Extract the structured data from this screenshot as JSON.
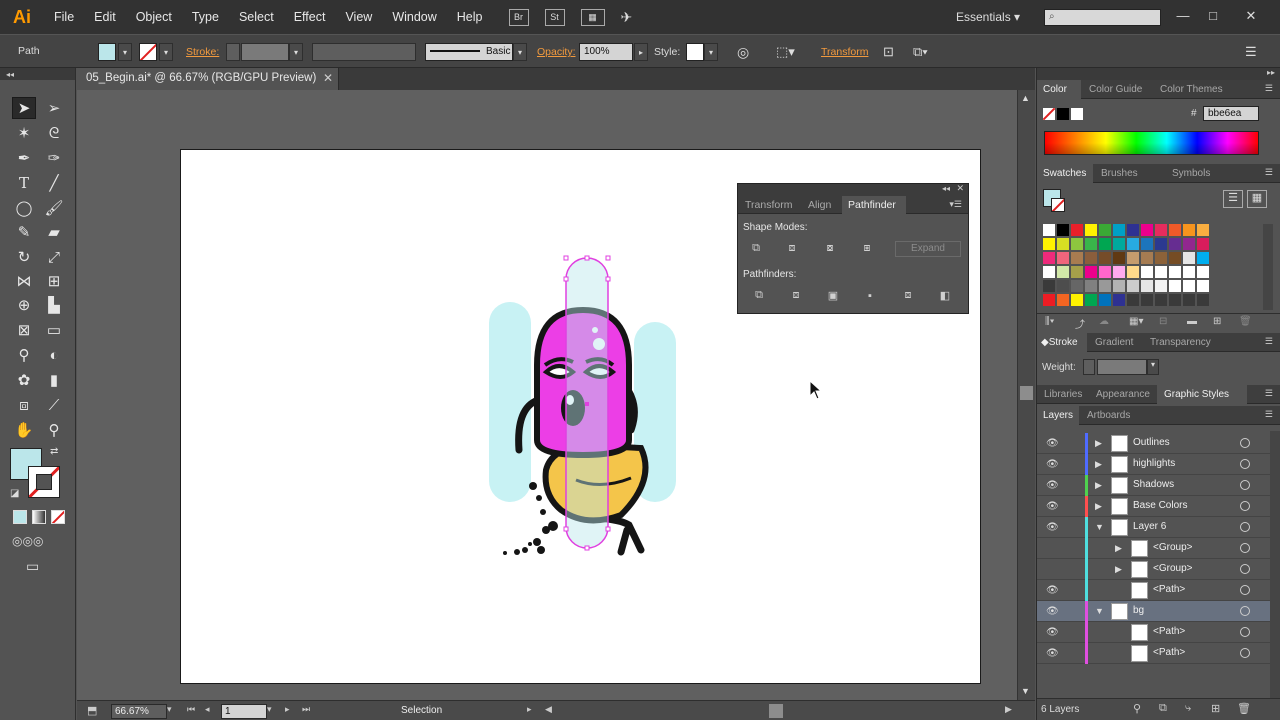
{
  "app": {
    "logo": "Ai",
    "menu": [
      "File",
      "Edit",
      "Object",
      "Type",
      "Select",
      "Effect",
      "View",
      "Window",
      "Help"
    ],
    "bridge_btn": "Br",
    "stock_btn": "St",
    "workspace": "Essentials"
  },
  "control": {
    "selection_type": "Path",
    "stroke_label": "Stroke:",
    "brush_label": "Basic",
    "opacity_label": "Opacity:",
    "opacity_value": "100%",
    "style_label": "Style:",
    "transform_label": "Transform",
    "fill_color": "#bbe6ea"
  },
  "document": {
    "tab_title": "05_Begin.ai* @ 66.67% (RGB/GPU Preview)",
    "zoom": "66.67%",
    "artboard": "1",
    "status_tool": "Selection"
  },
  "pathfinder": {
    "tabs": [
      "Transform",
      "Align",
      "Pathfinder"
    ],
    "shape_modes_label": "Shape Modes:",
    "pathfinders_label": "Pathfinders:",
    "expand_label": "Expand"
  },
  "color_panel": {
    "tabs": [
      "Color",
      "Color Guide",
      "Color Themes"
    ],
    "hex_label": "#",
    "hex": "bbe6ea"
  },
  "swatches_panel": {
    "tabs": [
      "Swatches",
      "Brushes",
      "Symbols"
    ],
    "rows": [
      [
        "#ffffff",
        "#000000",
        "#e8202a",
        "#fff200",
        "#3aa935",
        "#00a0c6",
        "#2e3192",
        "#ec008c",
        "#e62c5d",
        "#f05a28",
        "#f7941d",
        "#f9ae40"
      ],
      [
        "#fff200",
        "#d7df23",
        "#8dc63f",
        "#39b54a",
        "#00a651",
        "#00a99d",
        "#27aae1",
        "#1c75bc",
        "#2b3990",
        "#662d91",
        "#92278f",
        "#d91c5c"
      ],
      [
        "#ee2a7b",
        "#f0657c",
        "#a97c50",
        "#8b5e3c",
        "#754c29",
        "#603913",
        "#c69c6d",
        "#a67c52",
        "#8c6239",
        "#754c24",
        "#e6e6e6",
        "#00aeef"
      ],
      [
        "#ffffff",
        "#d2e8a8",
        "#a6a04a",
        "#ec008c",
        "#ff66cc",
        "#ffaaee",
        "#ffd98a",
        "#ffffff",
        "#ffffff",
        "#ffffff",
        "#ffffff",
        "#ffffff"
      ],
      [
        "#3a3a3a",
        "#4d4d4d",
        "#666666",
        "#808080",
        "#999999",
        "#b3b3b3",
        "#cccccc",
        "#e6e6e6",
        "#f2f2f2",
        "#ffffff",
        "#ffffff",
        "#ffffff"
      ],
      [
        "#ed1c24",
        "#f26522",
        "#fff200",
        "#00a651",
        "#0072bc",
        "#2e3192",
        "#3a3a3a",
        "#3a3a3a",
        "#3a3a3a",
        "#3a3a3a",
        "#3a3a3a",
        "#3a3a3a"
      ]
    ]
  },
  "stroke_panel": {
    "tabs": [
      "Stroke",
      "Gradient",
      "Transparency"
    ],
    "weight_label": "Weight:"
  },
  "styles_panel": {
    "tabs": [
      "Libraries",
      "Appearance",
      "Graphic Styles"
    ]
  },
  "layers_panel": {
    "tabs": [
      "Layers",
      "Artboards"
    ],
    "layers": [
      {
        "name": "Outlines",
        "color": "#4f6bff",
        "expanded": false,
        "indent": 0,
        "eye": true
      },
      {
        "name": "highlights",
        "color": "#4f6bff",
        "expanded": false,
        "indent": 0,
        "eye": true
      },
      {
        "name": "Shadows",
        "color": "#4fd14f",
        "expanded": false,
        "indent": 0,
        "eye": true
      },
      {
        "name": "Base Colors",
        "color": "#ff4f4f",
        "expanded": false,
        "indent": 0,
        "eye": true
      },
      {
        "name": "Layer 6",
        "color": "#4fdfdf",
        "expanded": true,
        "indent": 0,
        "eye": true
      },
      {
        "name": "<Group>",
        "color": "#4fdfdf",
        "expanded": false,
        "indent": 1,
        "eye": false
      },
      {
        "name": "<Group>",
        "color": "#4fdfdf",
        "expanded": false,
        "indent": 1,
        "eye": false
      },
      {
        "name": "<Path>",
        "color": "#4fdfdf",
        "expanded": null,
        "indent": 1,
        "eye": true
      },
      {
        "name": "bg",
        "color": "#e04fe0",
        "expanded": true,
        "indent": 0,
        "eye": true,
        "selected": true
      },
      {
        "name": "<Path>",
        "color": "#e04fe0",
        "expanded": null,
        "indent": 1,
        "eye": true
      },
      {
        "name": "<Path>",
        "color": "#e04fe0",
        "expanded": null,
        "indent": 1,
        "eye": true
      }
    ],
    "count": "6 Layers"
  }
}
